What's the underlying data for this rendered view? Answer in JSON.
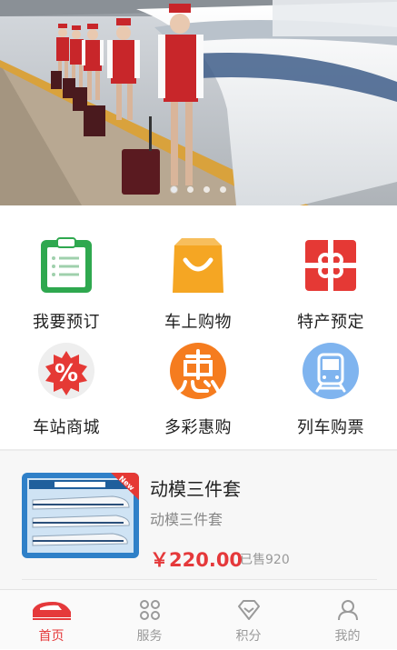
{
  "banner": {
    "slide_count": 4,
    "active_slide": 1
  },
  "menu": {
    "items": [
      {
        "label": "我要预订",
        "icon": "clipboard-icon"
      },
      {
        "label": "车上购物",
        "icon": "shopping-bag-icon"
      },
      {
        "label": "特产预定",
        "icon": "gift-box-icon"
      },
      {
        "label": "车站商城",
        "icon": "percent-badge-icon"
      },
      {
        "label": "多彩惠购",
        "icon": "hui-discount-icon"
      },
      {
        "label": "列车购票",
        "icon": "train-icon"
      }
    ]
  },
  "product": {
    "title": "动模三件套",
    "subtitle": "动模三件套",
    "price": "￥220.00",
    "sold": "已售920",
    "badge": "New"
  },
  "tabbar": {
    "items": [
      {
        "label": "首页",
        "icon": "train-front-icon",
        "active": true
      },
      {
        "label": "服务",
        "icon": "services-grid-icon",
        "active": false
      },
      {
        "label": "积分",
        "icon": "diamond-icon",
        "active": false
      },
      {
        "label": "我的",
        "icon": "user-icon",
        "active": false
      }
    ]
  },
  "colors": {
    "accent": "#e5393b",
    "inactive": "#9a9a9a"
  }
}
